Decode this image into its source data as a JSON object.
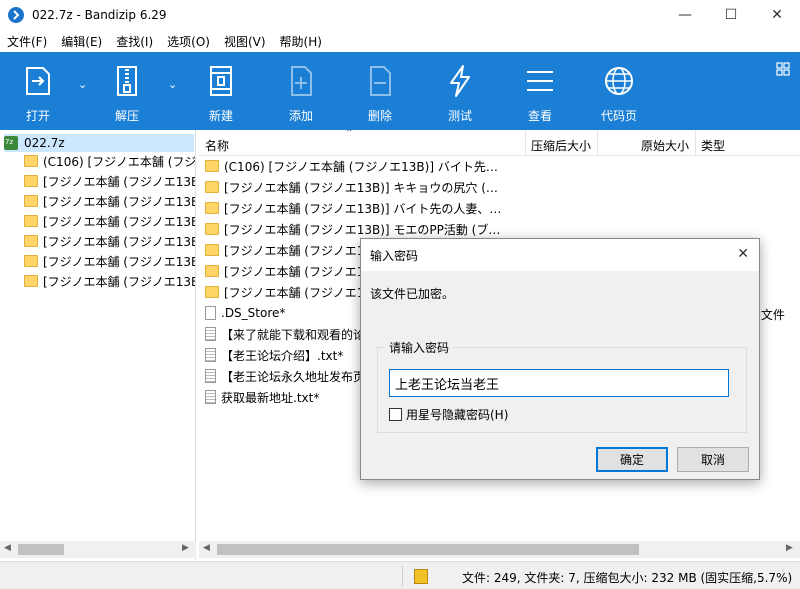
{
  "window": {
    "title": "022.7z - Bandizip 6.29",
    "minimize_glyph": "—",
    "maximize_glyph": "☐",
    "close_glyph": "✕"
  },
  "menu": [
    "文件(F)",
    "编辑(E)",
    "查找(I)",
    "选项(O)",
    "视图(V)",
    "帮助(H)"
  ],
  "toolbar": {
    "open": "打开",
    "extract": "解压",
    "new": "新建",
    "add": "添加",
    "delete": "删除",
    "test": "测试",
    "view": "查看",
    "codepage": "代码页",
    "dropdown_glyph": "⌄"
  },
  "tree": {
    "root": "022.7z",
    "items": [
      "(C106) [フジノエ本舗 (フジ",
      "[フジノエ本舗 (フジノエ13B",
      "[フジノエ本舗 (フジノエ13B",
      "[フジノエ本舗 (フジノエ13B",
      "[フジノエ本舗 (フジノエ13B",
      "[フジノエ本舗 (フジノエ13B",
      "[フジノエ本舗 (フジノエ13B"
    ]
  },
  "list": {
    "headers": {
      "name": "名称",
      "packed": "压缩后大小",
      "original": "原始大小",
      "type": "类型"
    },
    "sort_glyph": "⌃",
    "rows": [
      {
        "name": "(C106) [フジノエ本舗 (フジノエ13B)] バイト先…",
        "kind": "folder"
      },
      {
        "name": "[フジノエ本舗 (フジノエ13B)] キキョウの尻穴 (…",
        "kind": "folder"
      },
      {
        "name": "[フジノエ本舗 (フジノエ13B)] バイト先の人妻、…",
        "kind": "folder"
      },
      {
        "name": "[フジノエ本舗 (フジノエ13B)] モエのPP活動 (ブ…",
        "kind": "folder"
      },
      {
        "name": "[フジノエ本舗 (フジノエ13B",
        "kind": "folder"
      },
      {
        "name": "[フジノエ本舗 (フジノエ13B",
        "kind": "folder"
      },
      {
        "name": "[フジノエ本舗 (フジノエ13B",
        "kind": "folder"
      },
      {
        "name": ".DS_Store*",
        "kind": "file"
      },
      {
        "name": "【来了就能下载和观看的论",
        "kind": "txt"
      },
      {
        "name": "【老王论坛介绍】.txt*",
        "kind": "txt"
      },
      {
        "name": "【老王论坛永久地址发布页",
        "kind": "txt"
      },
      {
        "name": "获取最新地址.txt*",
        "kind": "txt"
      }
    ],
    "clipped_type": ": 文件"
  },
  "scroll": {
    "left_arrow": "◀",
    "right_arrow": "▶"
  },
  "status": {
    "text": "文件: 249, 文件夹: 7, 压缩包大小: 232 MB (固实压缩,5.7%)"
  },
  "dialog": {
    "title": "输入密码",
    "close_glyph": "✕",
    "message": "该文件已加密。",
    "group_label": "请输入密码",
    "password_value": "上老王论坛当老王",
    "checkbox_label": "用星号隐藏密码(H)",
    "ok": "确定",
    "cancel": "取消"
  },
  "colors": {
    "toolbar_bg": "#1b7fd6",
    "selection": "#cce8ff",
    "accent": "#0078d7"
  }
}
